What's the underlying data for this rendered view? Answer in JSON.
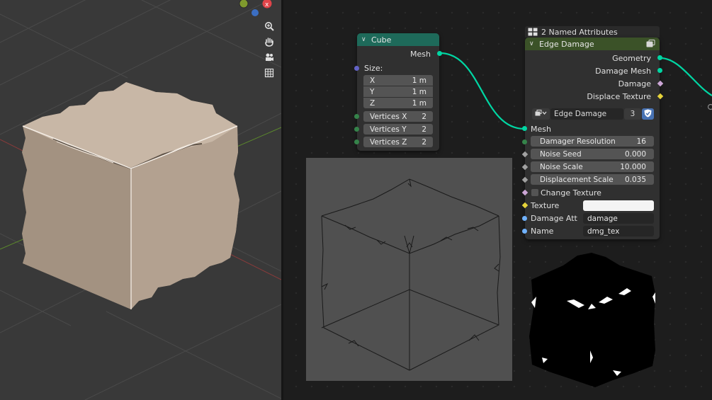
{
  "colors": {
    "geometry_socket": "#00d6a3",
    "vector_socket": "#6363c7",
    "int_socket": "#35834a",
    "float_socket": "#a1a1a1",
    "bool_socket": "#cca6d6",
    "texture_socket": "#e6d33a",
    "string_socket": "#70b2ff",
    "cube_header": "#1e6a5a",
    "group_header": "#3b5228",
    "cube_face": "#b7a595"
  },
  "viewport": {
    "tools": [
      "zoom-icon",
      "hand-icon",
      "camera-icon",
      "grid-icon"
    ]
  },
  "frame": {
    "label": "2 Named Attributes"
  },
  "cube_node": {
    "title": "Cube",
    "output": "Mesh",
    "size_label": "Size:",
    "fields": [
      {
        "label": "X",
        "value": "1 m"
      },
      {
        "label": "Y",
        "value": "1 m"
      },
      {
        "label": "Z",
        "value": "1 m"
      },
      {
        "label": "Vertices X",
        "value": "2"
      },
      {
        "label": "Vertices Y",
        "value": "2"
      },
      {
        "label": "Vertices Z",
        "value": "2"
      }
    ]
  },
  "group_node": {
    "title": "Edge Damage",
    "outputs": [
      "Geometry",
      "Damage Mesh",
      "Damage",
      "Displace Texture"
    ],
    "datablock_name": "Edge Damage",
    "users": "3",
    "mesh_input": "Mesh",
    "fields": [
      {
        "label": "Damager Resolution",
        "value": "16"
      },
      {
        "label": "Noise Seed",
        "value": "0.000"
      },
      {
        "label": "Noise Scale",
        "value": "10.000"
      },
      {
        "label": "Displacement Scale",
        "value": "0.035"
      }
    ],
    "checkbox_label": "Change Texture",
    "texture_label": "Texture",
    "damage_att_label": "Damage Att",
    "damage_att_value": "damage",
    "name_label": "Name",
    "name_value": "dmg_tex"
  }
}
